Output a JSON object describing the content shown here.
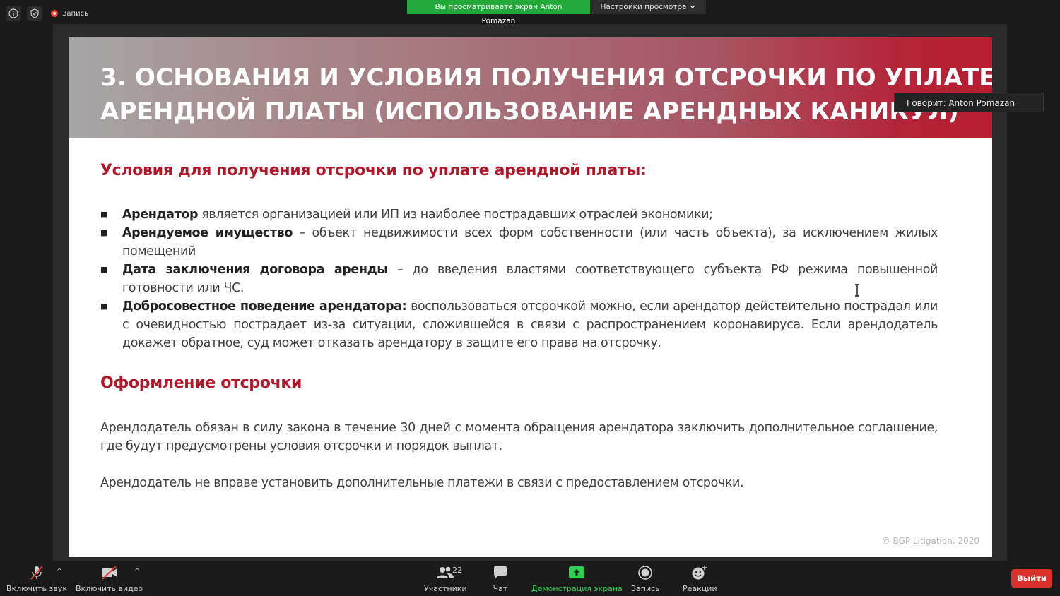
{
  "topbar": {
    "record_label": "Запись",
    "sharing_notice": "Вы просматриваете экран Anton Pomazan",
    "view_settings": "Настройки просмотра"
  },
  "slide": {
    "title_line1": "3. ОСНОВАНИЯ И УСЛОВИЯ ПОЛУЧЕНИЯ ОТСРОЧКИ ПО УПЛАТЕ",
    "title_line2": "АРЕНДНОЙ ПЛАТЫ (ИСПОЛЬЗОВАНИЕ АРЕНДНЫХ КАНИКУЛ)",
    "section1_heading": "Условия для получения отсрочки по уплате арендной платы:",
    "bullets": [
      {
        "bold": "Арендатор",
        "text": " является организацией или ИП из наиболее пострадавших отраслей экономики;"
      },
      {
        "bold": "Арендуемое имущество",
        "text": " – объект недвижимости всех форм собственности (или часть объекта), за исключением жилых помещений"
      },
      {
        "bold": "Дата заключения договора аренды",
        "text": " – до введения властями соответствующего субъекта РФ режима повышенной готовности или ЧС."
      },
      {
        "bold": "Добросовестное поведение арендатора:",
        "text": " воспользоваться отсрочкой можно, если арендатор действительно пострадал или с очевидностью пострадает из-за ситуации, сложившейся в связи с распространением коронавируса. Если арендодатель докажет обратное, суд может отказать арендатору в защите его права на отсрочку."
      }
    ],
    "section2_heading": "Оформление отсрочки",
    "para1": "Арендодатель обязан в силу закона в течение 30 дней с момента обращения арендатора заключить дополнительное соглашение, где будут предусмотрены условия отсрочки и порядок выплат.",
    "para2": "Арендодатель не вправе установить дополнительные платежи в связи с предоставлением отсрочки.",
    "copyright": "© BGP Litigation, 2020"
  },
  "speaker": "Говорит: Anton Pomazan",
  "toolbar": {
    "audio": "Включить звук",
    "video": "Включить видео",
    "participants": "Участники",
    "participants_count": "22",
    "chat": "Чат",
    "share": "Демонстрация экрана",
    "record": "Запись",
    "reactions": "Реакции",
    "leave": "Выйти"
  },
  "colors": {
    "accent_red": "#b0182a",
    "share_green": "#23a83a",
    "leave_red": "#d9302b"
  }
}
